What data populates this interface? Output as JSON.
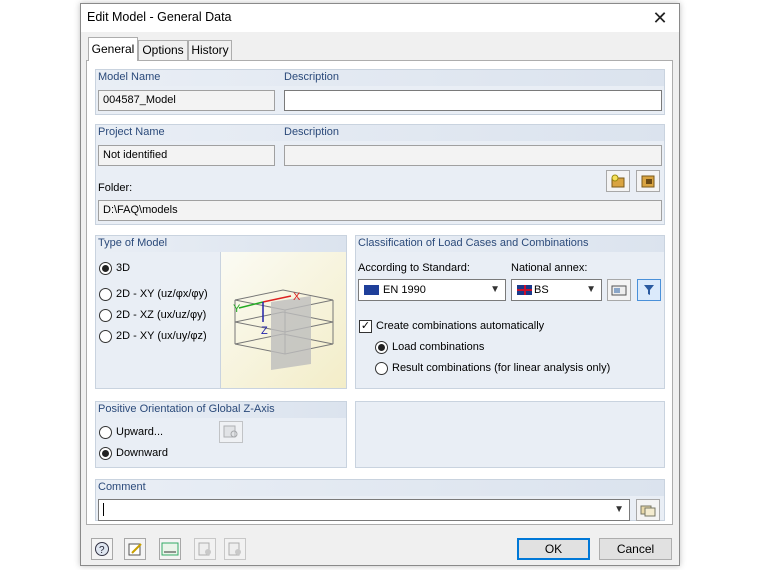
{
  "window": {
    "title": "Edit Model - General Data",
    "close_glyph": "✕"
  },
  "tabs": [
    {
      "label": "General",
      "active": true
    },
    {
      "label": "Options",
      "active": false
    },
    {
      "label": "History",
      "active": false
    }
  ],
  "model": {
    "name_label": "Model Name",
    "name_value": "004587_Model",
    "description_label": "Description",
    "description_value": ""
  },
  "project": {
    "name_label": "Project Name",
    "name_value": "Not identified",
    "description_label": "Description",
    "description_value": "",
    "folder_label": "Folder:",
    "folder_value": "D:\\FAQ\\models"
  },
  "type_of_model": {
    "header": "Type of Model",
    "options": [
      {
        "label": "3D",
        "selected": true
      },
      {
        "label": "2D - XY (uz/φx/φy)",
        "selected": false
      },
      {
        "label": "2D - XZ (ux/uz/φy)",
        "selected": false
      },
      {
        "label": "2D - XY (ux/uy/φz)",
        "selected": false
      }
    ],
    "axis_labels": {
      "x": "X",
      "y": "Y",
      "z": "Z"
    }
  },
  "classification": {
    "header": "Classification of Load Cases and Combinations",
    "standard_label": "According to Standard:",
    "standard_value": "EN 1990",
    "annex_label": "National annex:",
    "annex_value": "BS",
    "create_auto_label": "Create combinations automatically",
    "create_auto_checked": true,
    "combo_options": [
      {
        "label": "Load combinations",
        "selected": true
      },
      {
        "label": "Result combinations (for linear analysis only)",
        "selected": false
      }
    ]
  },
  "orientation": {
    "header": "Positive Orientation of Global Z-Axis",
    "options": [
      {
        "label": "Upward...",
        "selected": false
      },
      {
        "label": "Downward",
        "selected": true
      }
    ]
  },
  "comment": {
    "header": "Comment",
    "value": ""
  },
  "buttons": {
    "ok": "OK",
    "cancel": "Cancel"
  },
  "toolbar_icons": [
    "help-icon",
    "edit-icon",
    "units-icon",
    "import-icon",
    "export-icon"
  ],
  "colors": {
    "accent": "#0078d7",
    "group_header_text": "#2b4a7a",
    "group_bg": "#e9eef5"
  }
}
